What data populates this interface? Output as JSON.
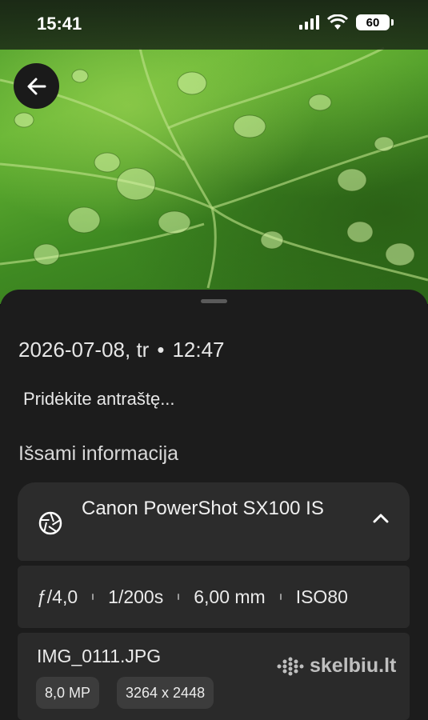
{
  "status_bar": {
    "time": "15:41",
    "battery": "60"
  },
  "photo": {
    "description_icon": "leaf-photo"
  },
  "details": {
    "datetime": {
      "date": "2026-07-08, tr",
      "separator": "•",
      "time": "12:47"
    },
    "caption_placeholder": "Pridėkite antraštę...",
    "section_title": "Išsami informacija",
    "camera": {
      "name": "Canon PowerShot SX100 IS"
    },
    "exif": {
      "aperture": "ƒ/4,0",
      "shutter": "1/200s",
      "focal": "6,00 mm",
      "iso": "ISO80"
    },
    "file": {
      "name": "IMG_0111.JPG",
      "megapixels": "8,0 MP",
      "resolution": "3264 x 2448"
    }
  },
  "watermark": {
    "text": "skelbiu.lt"
  }
}
